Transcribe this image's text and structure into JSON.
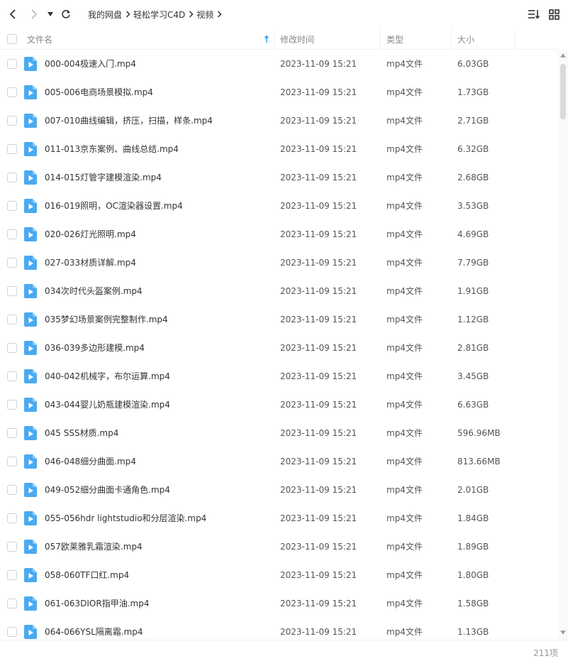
{
  "toolbar": {
    "back_icon": "chevron-left-icon",
    "forward_icon": "chevron-right-icon",
    "history_icon": "caret-down-icon",
    "refresh_icon": "refresh-icon",
    "sort_icon": "sort-list-icon",
    "grid_icon": "grid-view-icon"
  },
  "breadcrumb": [
    "我的网盘",
    "轻松学习C4D",
    "视频"
  ],
  "columns": {
    "name": "文件名",
    "modified": "修改时间",
    "type": "类型",
    "size": "大小"
  },
  "colors": {
    "accent": "#3aa0f0",
    "file_icon": "#4aaaf0"
  },
  "files": [
    {
      "name": "000-004极速入门.mp4",
      "modified": "2023-11-09 15:21",
      "type": "mp4文件",
      "size": "6.03GB"
    },
    {
      "name": "005-006电商场景模拟.mp4",
      "modified": "2023-11-09 15:21",
      "type": "mp4文件",
      "size": "1.73GB"
    },
    {
      "name": "007-010曲线编辑，挤压，扫描，样条.mp4",
      "modified": "2023-11-09 15:21",
      "type": "mp4文件",
      "size": "2.71GB"
    },
    {
      "name": "011-013京东案例、曲线总结.mp4",
      "modified": "2023-11-09 15:21",
      "type": "mp4文件",
      "size": "6.32GB"
    },
    {
      "name": "014-015灯管字建模渲染.mp4",
      "modified": "2023-11-09 15:21",
      "type": "mp4文件",
      "size": "2.68GB"
    },
    {
      "name": "016-019照明，OC渲染器设置.mp4",
      "modified": "2023-11-09 15:21",
      "type": "mp4文件",
      "size": "3.53GB"
    },
    {
      "name": "020-026灯光照明.mp4",
      "modified": "2023-11-09 15:21",
      "type": "mp4文件",
      "size": "4.69GB"
    },
    {
      "name": "027-033材质详解.mp4",
      "modified": "2023-11-09 15:21",
      "type": "mp4文件",
      "size": "7.79GB"
    },
    {
      "name": "034次时代头盔案例.mp4",
      "modified": "2023-11-09 15:21",
      "type": "mp4文件",
      "size": "1.91GB"
    },
    {
      "name": "035梦幻场景案例完整制作.mp4",
      "modified": "2023-11-09 15:21",
      "type": "mp4文件",
      "size": "1.12GB"
    },
    {
      "name": "036-039多边形建模.mp4",
      "modified": "2023-11-09 15:21",
      "type": "mp4文件",
      "size": "2.81GB"
    },
    {
      "name": "040-042机械字，布尔运算.mp4",
      "modified": "2023-11-09 15:21",
      "type": "mp4文件",
      "size": "3.45GB"
    },
    {
      "name": "043-044婴儿奶瓶建模渲染.mp4",
      "modified": "2023-11-09 15:21",
      "type": "mp4文件",
      "size": "6.63GB"
    },
    {
      "name": "045 SSS材质.mp4",
      "modified": "2023-11-09 15:21",
      "type": "mp4文件",
      "size": "596.96MB"
    },
    {
      "name": "046-048细分曲面.mp4",
      "modified": "2023-11-09 15:21",
      "type": "mp4文件",
      "size": "813.66MB"
    },
    {
      "name": "049-052细分曲面卡通角色.mp4",
      "modified": "2023-11-09 15:21",
      "type": "mp4文件",
      "size": "2.01GB"
    },
    {
      "name": "055-056hdr lightstudio和分层渲染.mp4",
      "modified": "2023-11-09 15:21",
      "type": "mp4文件",
      "size": "1.84GB"
    },
    {
      "name": "057欧莱雅乳霜渲染.mp4",
      "modified": "2023-11-09 15:21",
      "type": "mp4文件",
      "size": "1.89GB"
    },
    {
      "name": "058-060TF口红.mp4",
      "modified": "2023-11-09 15:21",
      "type": "mp4文件",
      "size": "1.80GB"
    },
    {
      "name": "061-063DIOR指甲油.mp4",
      "modified": "2023-11-09 15:21",
      "type": "mp4文件",
      "size": "1.58GB"
    },
    {
      "name": "064-066YSL隔离霜.mp4",
      "modified": "2023-11-09 15:21",
      "type": "mp4文件",
      "size": "1.13GB"
    }
  ],
  "footer": {
    "count": "211项"
  }
}
